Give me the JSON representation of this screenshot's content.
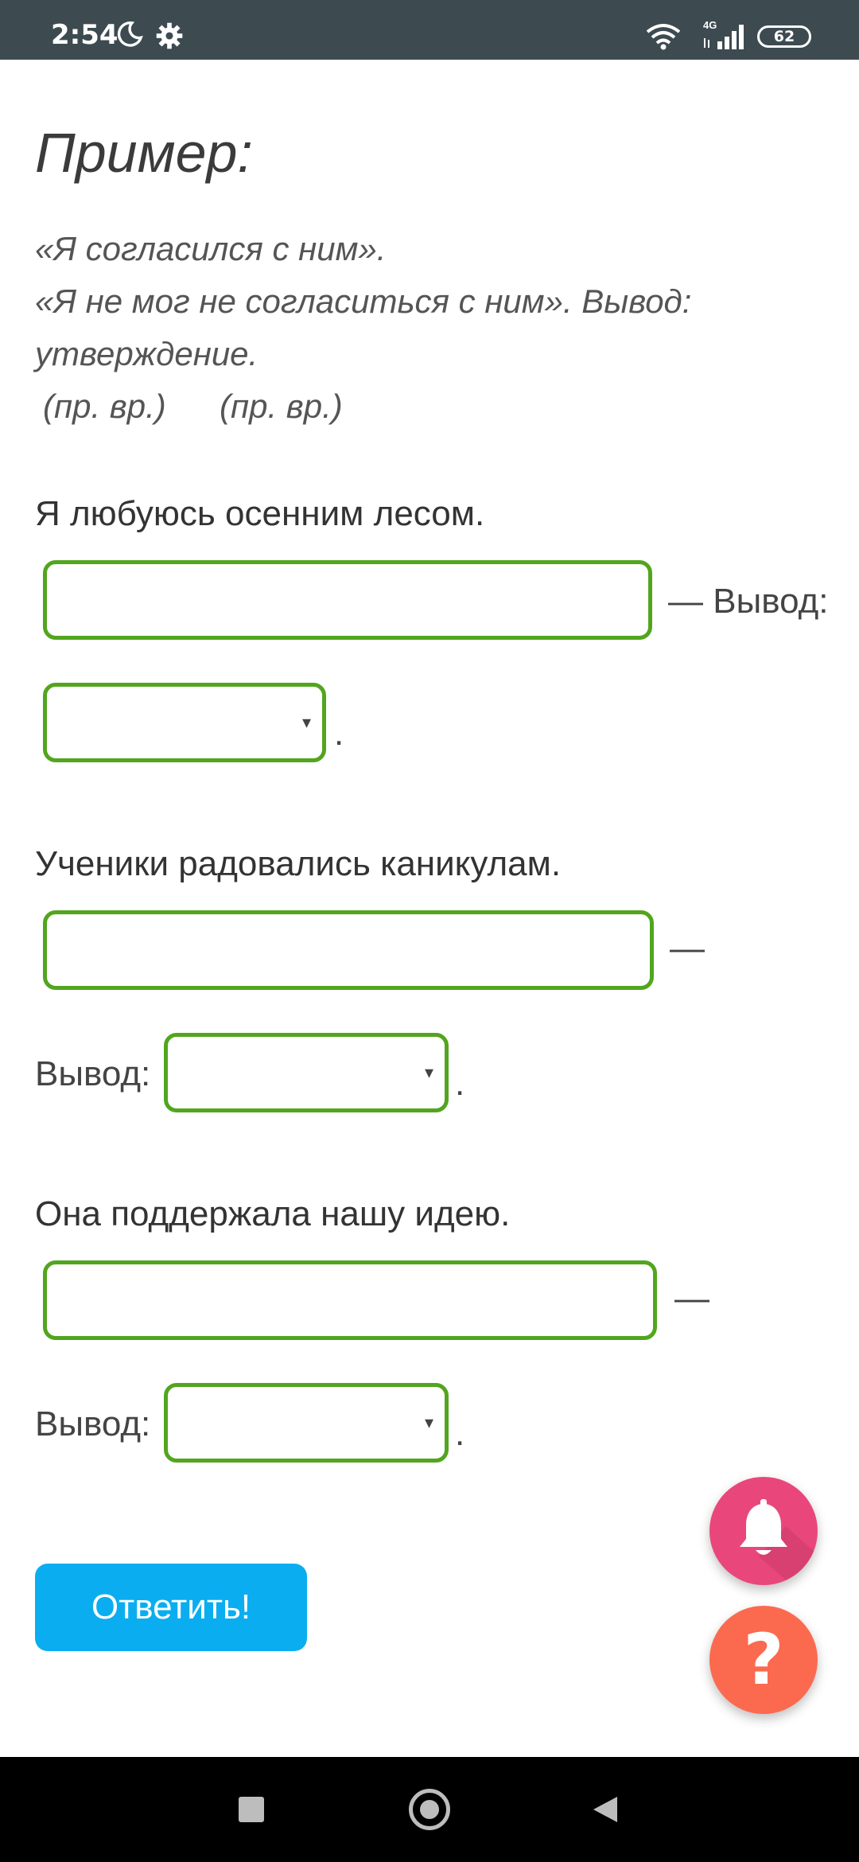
{
  "status_bar": {
    "time": "2:54",
    "network": "4G",
    "battery": "62",
    "icons": [
      "moon-icon",
      "gear-icon",
      "wifi-icon",
      "signal-icon",
      "battery-icon"
    ]
  },
  "example": {
    "title": "Пример:",
    "line1": "«Я согласился с ним».",
    "line2": "«Я не мог не согласиться с ним». Вывод:",
    "line3": "утверждение.",
    "tag1": "(пр. вр.)",
    "tag2": "(пр. вр.)"
  },
  "tasks": [
    {
      "sentence": "Я любуюсь осенним лесом.",
      "input_value": "",
      "dash_label": "— Вывод:",
      "select_value": "",
      "dot": "."
    },
    {
      "sentence": "Ученики радовались каникулам.",
      "input_value": "",
      "dash_label": "—",
      "conclusion_label": "Вывод:",
      "select_value": "",
      "dot": "."
    },
    {
      "sentence": "Она поддержала нашу идею.",
      "input_value": "",
      "dash_label": "—",
      "conclusion_label": "Вывод:",
      "select_value": "",
      "dot": "."
    }
  ],
  "select_arrow": "▾",
  "submit_label": "Ответить!",
  "fabs": {
    "bell_icon": "bell-icon",
    "help_glyph": "?"
  },
  "nav": {
    "icons": [
      "recents-icon",
      "home-icon",
      "back-icon"
    ]
  },
  "colors": {
    "status_bar": "#3d4b51",
    "field_border": "#52a51e",
    "submit": "#0aaef0",
    "bell_fab": "#e9477c",
    "help_fab": "#fb6a4f"
  }
}
